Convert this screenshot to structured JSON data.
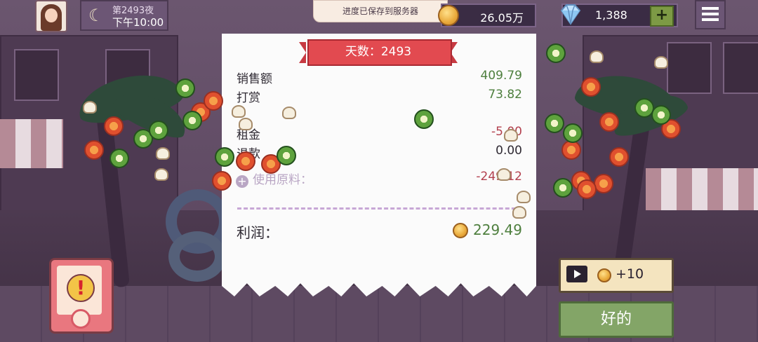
{
  "hud": {
    "night": "第2493夜",
    "time": "下午10:00",
    "toast": "进度已保存到服务器",
    "coins": "26.05万",
    "gems": "1,388",
    "add_gems_label": "+"
  },
  "receipt": {
    "title": "天数：2493",
    "rows": [
      {
        "label": "销售额",
        "value": "409.79"
      },
      {
        "label": "打赏",
        "value": "73.82"
      },
      {
        "label": "租金",
        "value": "-5.00"
      },
      {
        "label": "退款",
        "value": "0.00"
      }
    ],
    "materials_label": "使用原料：",
    "materials_value": "-249.12",
    "profit_label": "利润：",
    "profit_value": "229.49"
  },
  "buttons": {
    "ad_reward": "+10",
    "ok": "好的"
  },
  "icons": {
    "moon": "moon-icon",
    "coin": "coin-icon",
    "gem": "diamond-icon",
    "menu": "hamburger-menu-icon",
    "play": "video-play-icon",
    "alert": "exclamation-icon"
  },
  "colors": {
    "positive": "#4e7f3e",
    "negative": "#b3404e",
    "ribbon": "#e24a50",
    "ok_button": "#83a567",
    "ad_button": "#f4e4bf"
  }
}
